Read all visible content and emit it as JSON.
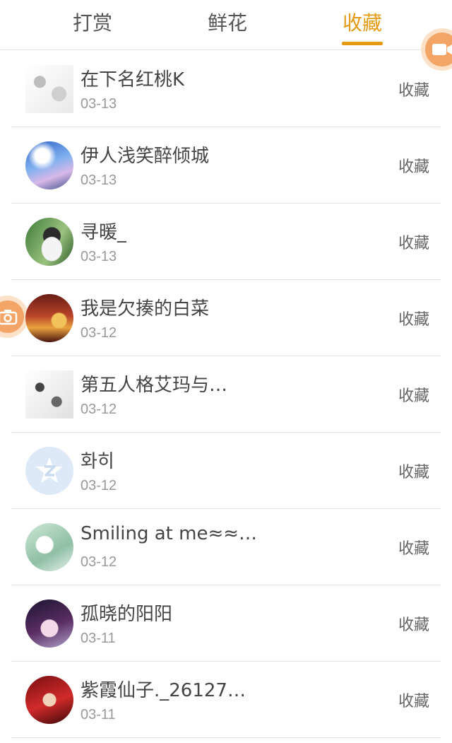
{
  "tabs": [
    {
      "label": "打赏"
    },
    {
      "label": "鲜花"
    },
    {
      "label": "收藏",
      "active": true
    }
  ],
  "accent_color": "#e49a12",
  "float_buttons": {
    "video_icon": "video-camera-icon",
    "camera_icon": "camera-icon"
  },
  "list": [
    {
      "name": "在下名红桃K",
      "date": "03-13",
      "action": "收藏",
      "avatar": "avatar-image"
    },
    {
      "name": "伊人浅笑醉倾城",
      "date": "03-13",
      "action": "收藏",
      "avatar": "avatar-image"
    },
    {
      "name": "寻暖_",
      "date": "03-13",
      "action": "收藏",
      "avatar": "avatar-image"
    },
    {
      "name": "我是欠揍的白菜",
      "date": "03-12",
      "action": "收藏",
      "avatar": "avatar-image"
    },
    {
      "name": "第五人格艾玛与…",
      "date": "03-12",
      "action": "收藏",
      "avatar": "avatar-image"
    },
    {
      "name": "화히",
      "date": "03-12",
      "action": "收藏",
      "avatar": "qq-default-icon"
    },
    {
      "name": "Smiling at me≈≈…",
      "date": "03-12",
      "action": "收藏",
      "avatar": "avatar-image"
    },
    {
      "name": "孤晓的阳阳",
      "date": "03-11",
      "action": "收藏",
      "avatar": "avatar-image"
    },
    {
      "name": "紫霞仙子._26127…",
      "date": "03-11",
      "action": "收藏",
      "avatar": "avatar-image"
    }
  ]
}
